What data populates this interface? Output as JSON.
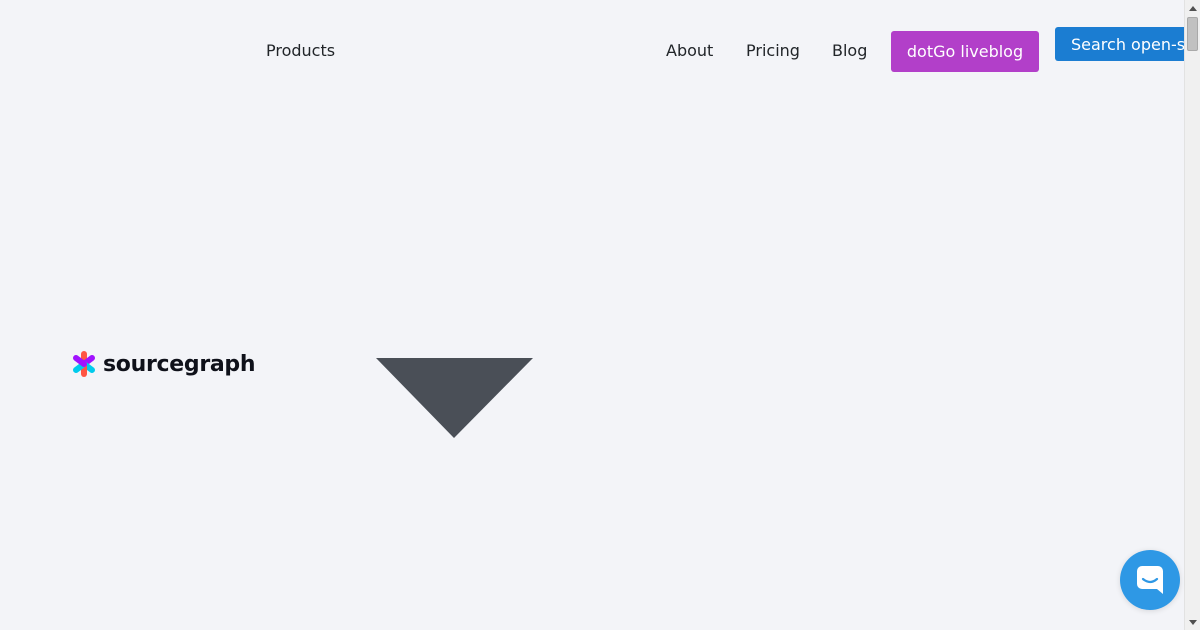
{
  "nav": {
    "products": "Products",
    "about": "About",
    "pricing": "Pricing",
    "blog": "Blog",
    "live_button": "dotGo liveblog",
    "search_button": "Search open-source"
  },
  "logo": {
    "text": "sourcegraph"
  },
  "colors": {
    "background": "#f3f4f8",
    "live_button": "#b23fc9",
    "search_button": "#1b7dd2",
    "triangle": "#4a4f57",
    "chat_launcher": "#2e98e5"
  },
  "icons": {
    "logo_mark": "sourcegraph-star-icon",
    "dropdown": "caret-down-icon",
    "chat": "chat-bubble-icon"
  }
}
